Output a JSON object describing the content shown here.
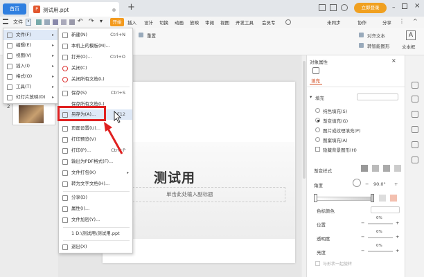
{
  "titlebar": {
    "home_tab": "首页",
    "doc_tab": "测试用.ppt",
    "new_tab": "+",
    "login": "立即登录"
  },
  "menurow": {
    "file_btn": "文件",
    "tabs": [
      "开始",
      "插入",
      "设计",
      "切换",
      "动画",
      "放映",
      "审阅",
      "视图",
      "开发工具",
      "会员专"
    ],
    "right": [
      "未同步",
      "协作",
      "分享"
    ]
  },
  "ribbon": {
    "labels": [
      "重置",
      "对齐文本",
      "转智能图形",
      "文本框"
    ]
  },
  "file_menu": {
    "items": [
      {
        "label": "文件(F)",
        "arrow": "▸"
      },
      {
        "label": "编辑(E)",
        "arrow": "▸"
      },
      {
        "label": "视图(V)",
        "arrow": "▸"
      },
      {
        "label": "插入(I)",
        "arrow": "▸"
      },
      {
        "label": "格式(O)",
        "arrow": "▸"
      },
      {
        "label": "工具(T)",
        "arrow": "▸"
      },
      {
        "label": "幻灯片放映(D)",
        "arrow": "▸"
      }
    ]
  },
  "submenu": {
    "items": [
      {
        "label": "新建(N)",
        "shortcut": "Ctrl+N"
      },
      {
        "label": "本机上的模板(M)...",
        "shortcut": ""
      },
      {
        "label": "打开(O)...",
        "shortcut": "Ctrl+O"
      },
      {
        "label": "关闭(C)",
        "shortcut": ""
      },
      {
        "label": "关闭所有文档(L)",
        "shortcut": ""
      },
      {
        "label": "保存(S)",
        "shortcut": "Ctrl+S"
      },
      {
        "label": "保存所有文档(L)",
        "shortcut": ""
      },
      {
        "label": "另存为(A)...",
        "shortcut": "F12"
      },
      {
        "label": "页面设置(U)...",
        "shortcut": ""
      },
      {
        "label": "打印预览(V)",
        "shortcut": ""
      },
      {
        "label": "打印(P)...",
        "shortcut": "Ctrl+P"
      },
      {
        "label": "输出为PDF格式(F)...",
        "shortcut": ""
      },
      {
        "label": "文件打包(K)",
        "shortcut": ""
      },
      {
        "label": "转为文字文档(H)...",
        "shortcut": ""
      },
      {
        "label": "分享(D)",
        "shortcut": ""
      },
      {
        "label": "属性(I)...",
        "shortcut": ""
      },
      {
        "label": "文件加密(Y)...",
        "shortcut": ""
      },
      {
        "label": "1 D:\\测试用\\测试用.ppt",
        "shortcut": ""
      },
      {
        "label": "退出(X)",
        "shortcut": ""
      }
    ]
  },
  "thumbnails": {
    "num2": "2"
  },
  "slide": {
    "title": "测试用",
    "subtitle": "单击此处输入副标题"
  },
  "property_pane": {
    "header": "对象属性",
    "fill_tab": "填充",
    "section_fill": "填充",
    "options": [
      "纯色填充(S)",
      "渐变填充(G)",
      "图片或纹理填充(P)",
      "图案填充(A)",
      "隐藏背景图形(H)"
    ],
    "gradient_style": "渐变样式",
    "angle_label": "角度",
    "angle_value": "90.0°",
    "stop_color": "色标颜色",
    "position": "位置",
    "position_value": "0%",
    "transparency": "透明度",
    "transparency_value": "0%",
    "brightness": "亮度",
    "brightness_value": "0%",
    "rotate_with_shape": "与形状一起旋转"
  }
}
